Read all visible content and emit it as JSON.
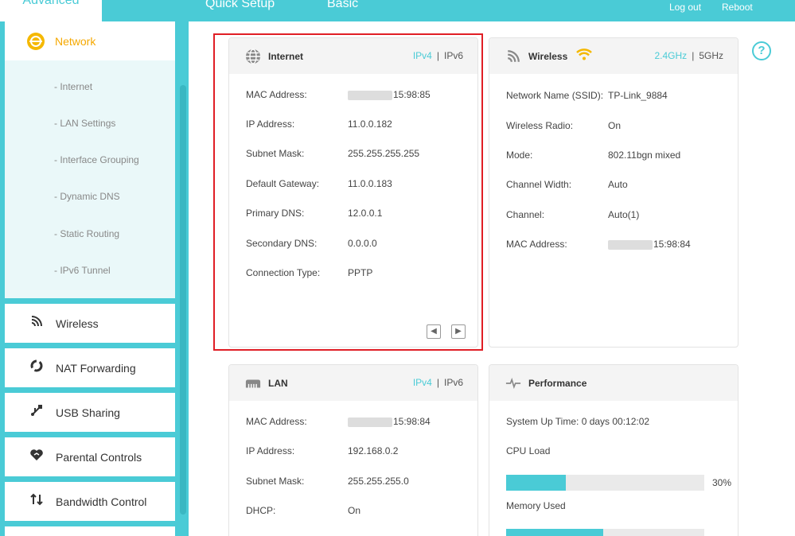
{
  "topnav": {
    "tabs": [
      "Quick Setup",
      "Basic",
      "Advanced"
    ],
    "active_tab": "Advanced",
    "logout": "Log out",
    "reboot": "Reboot"
  },
  "sidebar": {
    "network": {
      "label": "Network",
      "subitems": [
        "- Internet",
        "- LAN Settings",
        "- Interface Grouping",
        "- Dynamic DNS",
        "- Static Routing",
        "- IPv6 Tunnel"
      ]
    },
    "items": [
      {
        "label": "Wireless",
        "icon": "wireless-icon"
      },
      {
        "label": "NAT Forwarding",
        "icon": "nat-icon"
      },
      {
        "label": "USB Sharing",
        "icon": "usb-icon"
      },
      {
        "label": "Parental Controls",
        "icon": "heart-icon"
      },
      {
        "label": "Bandwidth Control",
        "icon": "bandwidth-icon"
      }
    ]
  },
  "internet": {
    "title": "Internet",
    "proto_on": "IPv4",
    "proto_off": "IPv6",
    "rows": [
      {
        "label": "MAC Address:",
        "value": "15:98:85"
      },
      {
        "label": "IP Address:",
        "value": "11.0.0.182"
      },
      {
        "label": "Subnet Mask:",
        "value": "255.255.255.255"
      },
      {
        "label": "Default Gateway:",
        "value": "11.0.0.183"
      },
      {
        "label": "Primary DNS:",
        "value": "12.0.0.1"
      },
      {
        "label": "Secondary DNS:",
        "value": "0.0.0.0"
      },
      {
        "label": "Connection Type:",
        "value": "PPTP"
      }
    ]
  },
  "wireless": {
    "title": "Wireless",
    "band_on": "2.4GHz",
    "band_off": "5GHz",
    "rows": [
      {
        "label": "Network Name (SSID):",
        "value": "TP-Link_9884"
      },
      {
        "label": "Wireless Radio:",
        "value": "On"
      },
      {
        "label": "Mode:",
        "value": "802.11bgn mixed"
      },
      {
        "label": "Channel Width:",
        "value": "Auto"
      },
      {
        "label": "Channel:",
        "value": "Auto(1)"
      },
      {
        "label": "MAC Address:",
        "value": "15:98:84"
      }
    ]
  },
  "lan": {
    "title": "LAN",
    "proto_on": "IPv4",
    "proto_off": "IPv6",
    "rows": [
      {
        "label": "MAC Address:",
        "value": "15:98:84"
      },
      {
        "label": "IP Address:",
        "value": "192.168.0.2"
      },
      {
        "label": "Subnet Mask:",
        "value": "255.255.255.0"
      },
      {
        "label": "DHCP:",
        "value": "On"
      }
    ]
  },
  "performance": {
    "title": "Performance",
    "uptime": "System Up Time: 0 days 00:12:02",
    "cpu_label": "CPU Load",
    "cpu_value": "30%",
    "cpu_fraction": 0.3,
    "memory_label": "Memory Used",
    "memory_fraction": 0.49
  },
  "colors": {
    "accent": "#4acbd6",
    "highlight": "#e01e25",
    "network": "#f5a800"
  }
}
